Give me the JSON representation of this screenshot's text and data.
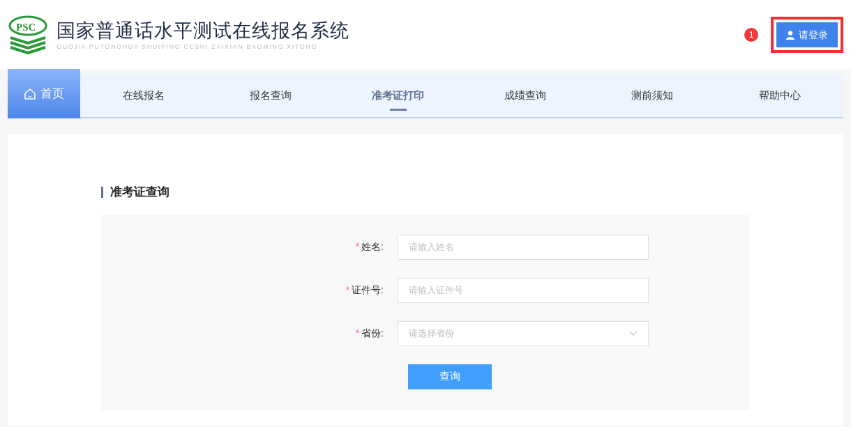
{
  "header": {
    "logo_text": "PSC",
    "title": "国家普通话水平测试在线报名系统",
    "subtitle": "GUOJIA PUTONGHUA SHUIPING CESHI ZAIXIAN BAOMING XITONG",
    "badge": "1",
    "login_button": {
      "label": "请登录",
      "highlighted": true
    }
  },
  "nav": [
    {
      "label": "首页",
      "kind": "home",
      "selected": false
    },
    {
      "label": "在线报名",
      "kind": "link",
      "selected": false
    },
    {
      "label": "报名查询",
      "kind": "link",
      "selected": false
    },
    {
      "label": "准考证打印",
      "kind": "link",
      "selected": true
    },
    {
      "label": "成绩查询",
      "kind": "link",
      "selected": false
    },
    {
      "label": "测前须知",
      "kind": "link",
      "selected": false
    },
    {
      "label": "帮助中心",
      "kind": "link",
      "selected": false
    }
  ],
  "section_title": "准考证查询",
  "form": {
    "fields": [
      {
        "required_mark": "*",
        "label": "姓名:",
        "placeholder": "请输入姓名",
        "kind": "text"
      },
      {
        "required_mark": "*",
        "label": "证件号:",
        "placeholder": "请输入证件号",
        "kind": "text"
      },
      {
        "required_mark": "*",
        "label": "省份:",
        "placeholder": "请选择省份",
        "kind": "select"
      }
    ],
    "submit": "查询"
  }
}
